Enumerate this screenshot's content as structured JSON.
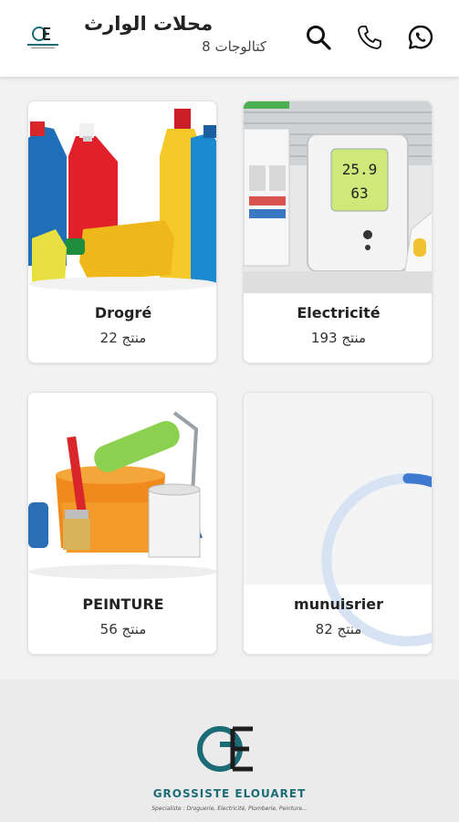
{
  "header": {
    "title": "محلات الوارث",
    "subtitle": "كتالوجات 8",
    "icons": [
      "search-icon",
      "phone-icon",
      "whatsapp-icon"
    ]
  },
  "categories": [
    {
      "name": "Drogré",
      "count": "منتج 22"
    },
    {
      "name": "Electricité",
      "count": "منتج 193"
    },
    {
      "name": "PEINTURE",
      "count": "منتج 56"
    },
    {
      "name": "munuisrier",
      "count": "منتج 82"
    }
  ],
  "thermo": {
    "line1": "25.9",
    "line2": "63"
  },
  "footer": {
    "brand_name": "GROSSISTE ELOUARET",
    "tagline": "Specialiste : Droguerie, Electricité, Plomberie, Peinture..."
  },
  "colors": {
    "accent": "#1b6c77",
    "header_bg": "#ffffff",
    "page_bg": "#f2f2f2"
  }
}
